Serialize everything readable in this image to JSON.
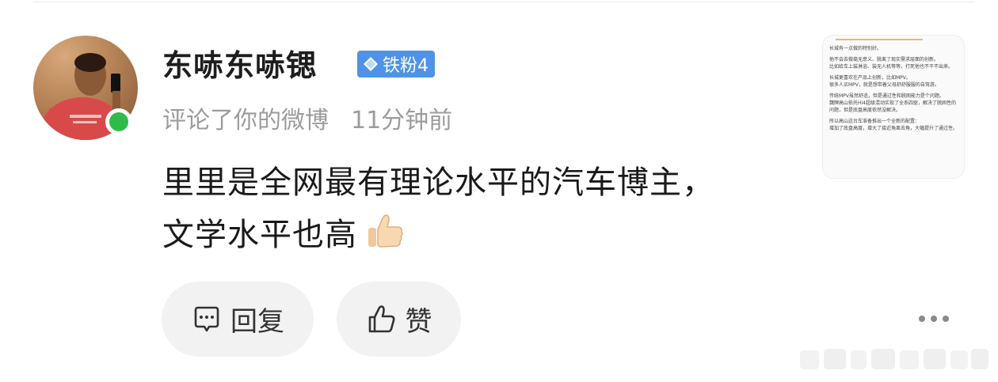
{
  "comment": {
    "username": "东哧东哧锶",
    "badge_label": "铁粉4",
    "action_text": "评论了你的微博",
    "time_text": "11分钟前",
    "text_line1": "里里是全网最有理论水平的汽车博主，",
    "text_line2": "文学水平也高"
  },
  "thumbnail": {
    "paragraphs": [
      "长城有一点做的特别好。",
      "他不会去做毫无意义、脱离了现实需求层面的创新。\n比如给车上装淋浴、装无人机等等，打死他也不干不出来。",
      "长城更喜欢在产品上创新，比如MPV。\n很多人买MPV，就是想带着父母舒舒服服的自驾游。",
      "传统MPV虽然舒适，但是通过性和脱困能力是个问题。\n魏牌高山依托Hi4超级混动实现了全系四驱，解决了脱困性的问题，但是底盘高度依然没解决。",
      "所以高山这台车准备推出一个全新的配置：\n增加了底盘高度，增大了接近角离去角，大幅提升了通过性。"
    ]
  },
  "actions": {
    "reply_label": "回复",
    "like_label": "赞"
  },
  "colors": {
    "badge": "#4f93e8",
    "online": "#2fbb4b",
    "button_bg": "#f2f2f2"
  }
}
